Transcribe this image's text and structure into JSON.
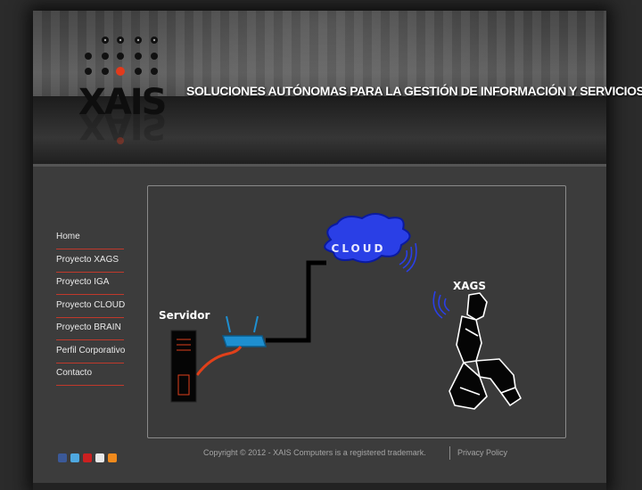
{
  "header": {
    "logo_text": "XAIS",
    "tagline": "SOLUCIONES AUTÓNOMAS PARA LA GESTIÓN DE INFORMACIÓN Y SERVICIOS"
  },
  "nav": {
    "items": [
      {
        "label": "Home"
      },
      {
        "label": "Proyecto XAGS"
      },
      {
        "label": "Proyecto IGA"
      },
      {
        "label": "Proyecto CLOUD"
      },
      {
        "label": "Proyecto BRAIN"
      },
      {
        "label": "Perfil Corporativo"
      },
      {
        "label": "Contacto"
      }
    ]
  },
  "diagram": {
    "cloud_label": "CLOUD",
    "server_label": "Servidor",
    "robot_label": "XAGS",
    "colors": {
      "cloud": "#2a3fe6",
      "cable_red": "#e0401a",
      "router": "#1e8fd0",
      "wifi": "#2a3fe6"
    }
  },
  "footer": {
    "social": [
      "facebook-icon",
      "twitter-icon",
      "youtube-icon",
      "email-icon",
      "rss-icon"
    ],
    "copyright": "Copyright © 2012 - XAIS Computers is a registered trademark.",
    "privacy": "Privacy Policy"
  }
}
